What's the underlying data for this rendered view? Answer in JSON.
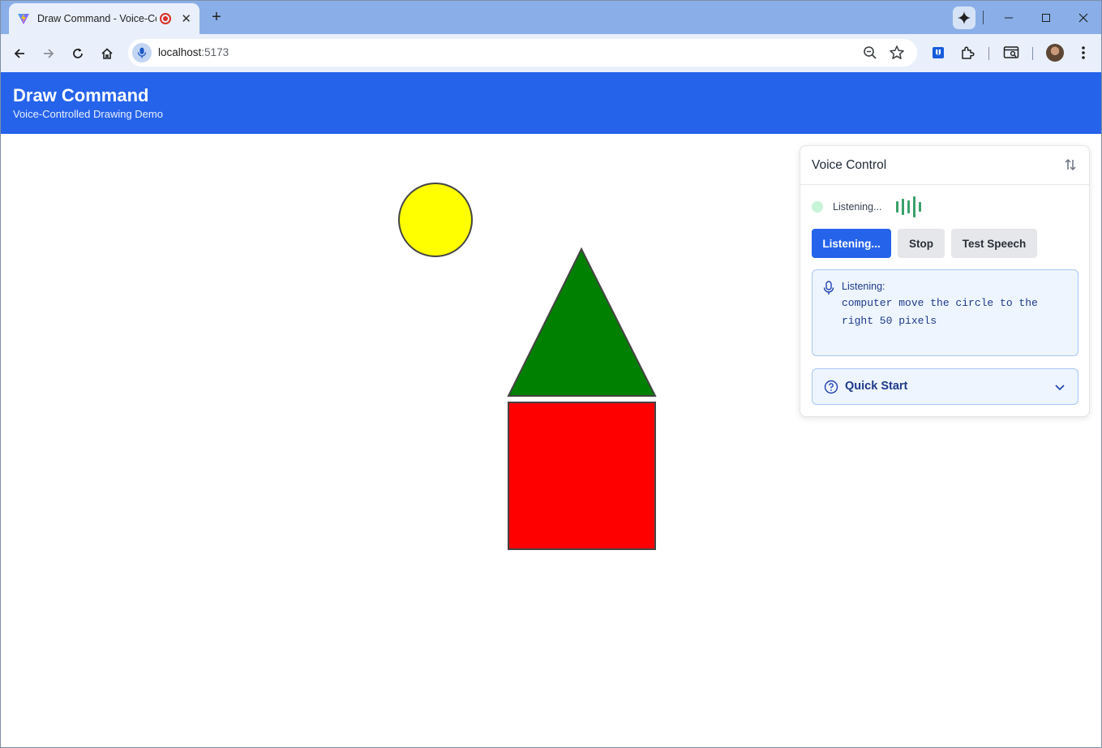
{
  "browser": {
    "tab": {
      "title": "Draw Command - Voice-Controlled Drawing Demo",
      "close": "✕"
    },
    "new_tab": "+",
    "address": {
      "host": "localhost",
      "port": ":5173"
    }
  },
  "app": {
    "title": "Draw Command",
    "subtitle": "Voice-Controlled Drawing Demo"
  },
  "canvas": {
    "shapes": [
      {
        "kind": "circle",
        "fill": "#ffff00",
        "stroke": "#444444"
      },
      {
        "kind": "triangle",
        "fill": "#008000",
        "stroke": "#444444"
      },
      {
        "kind": "square",
        "fill": "#ff0000",
        "stroke": "#444444"
      }
    ]
  },
  "voice_panel": {
    "title": "Voice Control",
    "status": "Listening...",
    "buttons": {
      "listen": "Listening...",
      "stop": "Stop",
      "test": "Test Speech"
    },
    "transcript": {
      "label": "Listening:",
      "text": "computer move the circle to the right 50 pixels"
    },
    "quick_start": "Quick Start"
  },
  "colors": {
    "accent": "#2563eb",
    "listening_dot": "#c8f4d8",
    "waveform": "#3aa06a",
    "transcript_bg": "#eef5ff",
    "transcript_text": "#1e3a8a"
  },
  "icons": {
    "favicon": "vite-logo-icon",
    "record": "recording-icon",
    "address_mic": "microphone-icon",
    "zoom": "zoom-out-icon",
    "bookmark": "star-icon",
    "panel_toggle": "swap-vertical-icon",
    "transcript_mic": "microphone-icon",
    "quick_start": "help-circle-icon",
    "expand": "chevron-down-icon"
  }
}
